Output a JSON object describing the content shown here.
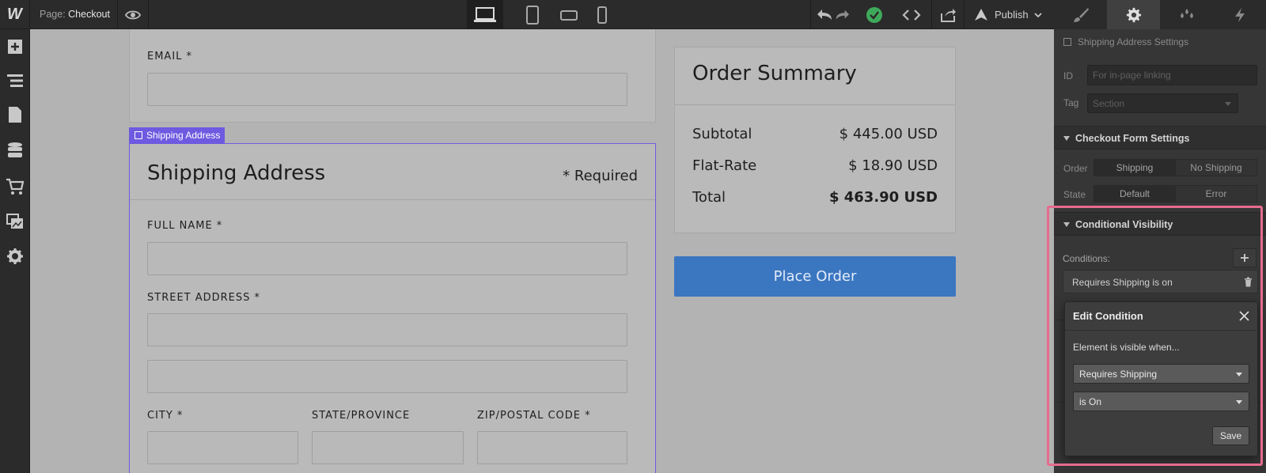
{
  "topbar": {
    "logo": "W",
    "page_prefix": "Page:",
    "page_name": "Checkout",
    "publish_label": "Publish"
  },
  "icons": {
    "preview": "eye-icon",
    "undo": "undo-icon",
    "redo": "redo-icon",
    "status": "check-circle-icon",
    "code": "code-icon",
    "export": "export-icon"
  },
  "right_panel": {
    "section_checkbox_label": "Shipping Address Settings",
    "id_label": "ID",
    "id_placeholder": "For in-page linking",
    "tag_label": "Tag",
    "tag_value": "Section",
    "checkout_title": "Checkout Form Settings",
    "order_label": "Order",
    "order_options": [
      "Shipping",
      "No Shipping"
    ],
    "state_label": "State",
    "state_options": [
      "Default",
      "Error"
    ],
    "cv_title": "Conditional Visibility",
    "conditions_label": "Conditions:",
    "condition_text": "Requires Shipping is on"
  },
  "popup": {
    "title": "Edit Condition",
    "subtitle": "Element is visible when...",
    "field_select": "Requires Shipping",
    "operator_select": "is On",
    "save_label": "Save"
  },
  "canvas": {
    "email_label": "EMAIL *",
    "selection_tag": "Shipping Address",
    "shipping_title": "Shipping Address",
    "required_note": "* Required",
    "full_name_label": "FULL NAME *",
    "street_label": "STREET ADDRESS *",
    "city_label": "CITY *",
    "state_label": "STATE/PROVINCE",
    "zip_label": "ZIP/POSTAL CODE *",
    "summary": {
      "title": "Order Summary",
      "rows": [
        {
          "label": "Subtotal",
          "value": "$ 445.00 USD"
        },
        {
          "label": "Flat-Rate",
          "value": "$ 18.90 USD"
        },
        {
          "label": "Total",
          "value": "$ 463.90 USD"
        }
      ]
    },
    "place_order": "Place Order"
  },
  "colors": {
    "accent_highlight": "#e66b8f",
    "selection": "#6d5ae0",
    "primary_button": "#3b76c0",
    "success": "#3fa95b"
  }
}
